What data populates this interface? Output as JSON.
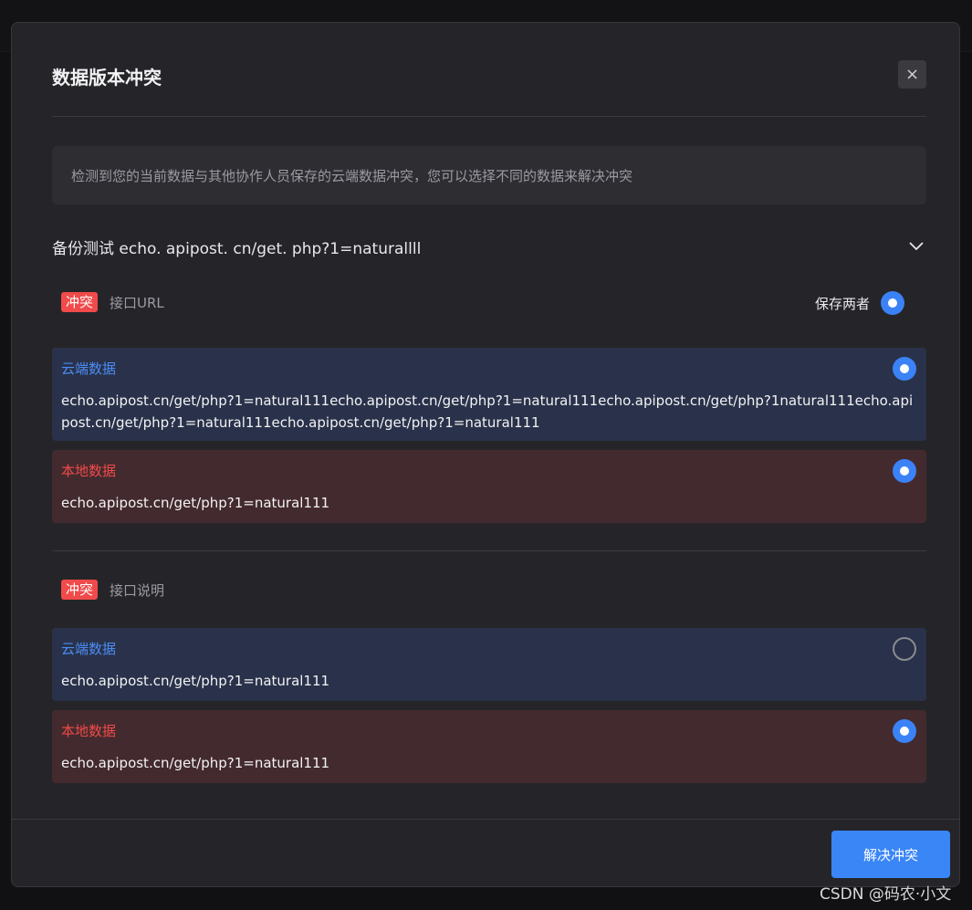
{
  "modal": {
    "title": "数据版本冲突",
    "close_symbol": "×",
    "notice": "检测到您的当前数据与其他协作人员保存的云端数据冲突，您可以选择不同的数据来解决冲突",
    "section_title": "备份测试 echo. apipost. cn/get. php?1=naturallll",
    "keep_both_label": "保存两者",
    "conflicts": [
      {
        "badge": "冲突",
        "field": "接口URL",
        "cloud": {
          "label": "云端数据",
          "value": "echo.apipost.cn/get/php?1=natural111echo.apipost.cn/get/php?1=natural111echo.apipost.cn/get/php?1natural111echo.apipost.cn/get/php?1=natural111echo.apipost.cn/get/php?1=natural111",
          "selected": true
        },
        "local": {
          "label": "本地数据",
          "value": "echo.apipost.cn/get/php?1=natural111",
          "selected": true
        }
      },
      {
        "badge": "冲突",
        "field": "接口说明",
        "cloud": {
          "label": "云端数据",
          "value": "echo.apipost.cn/get/php?1=natural111",
          "selected": false
        },
        "local": {
          "label": "本地数据",
          "value": "echo.apipost.cn/get/php?1=natural111",
          "selected": true
        }
      }
    ],
    "resolve_button": "解决冲突"
  },
  "watermark": "CSDN @码农·小文",
  "colors": {
    "accent": "#3b82f6",
    "conflict_red": "#f04a4a",
    "cloud_bg": "#29324a",
    "local_bg": "#432a2e"
  }
}
